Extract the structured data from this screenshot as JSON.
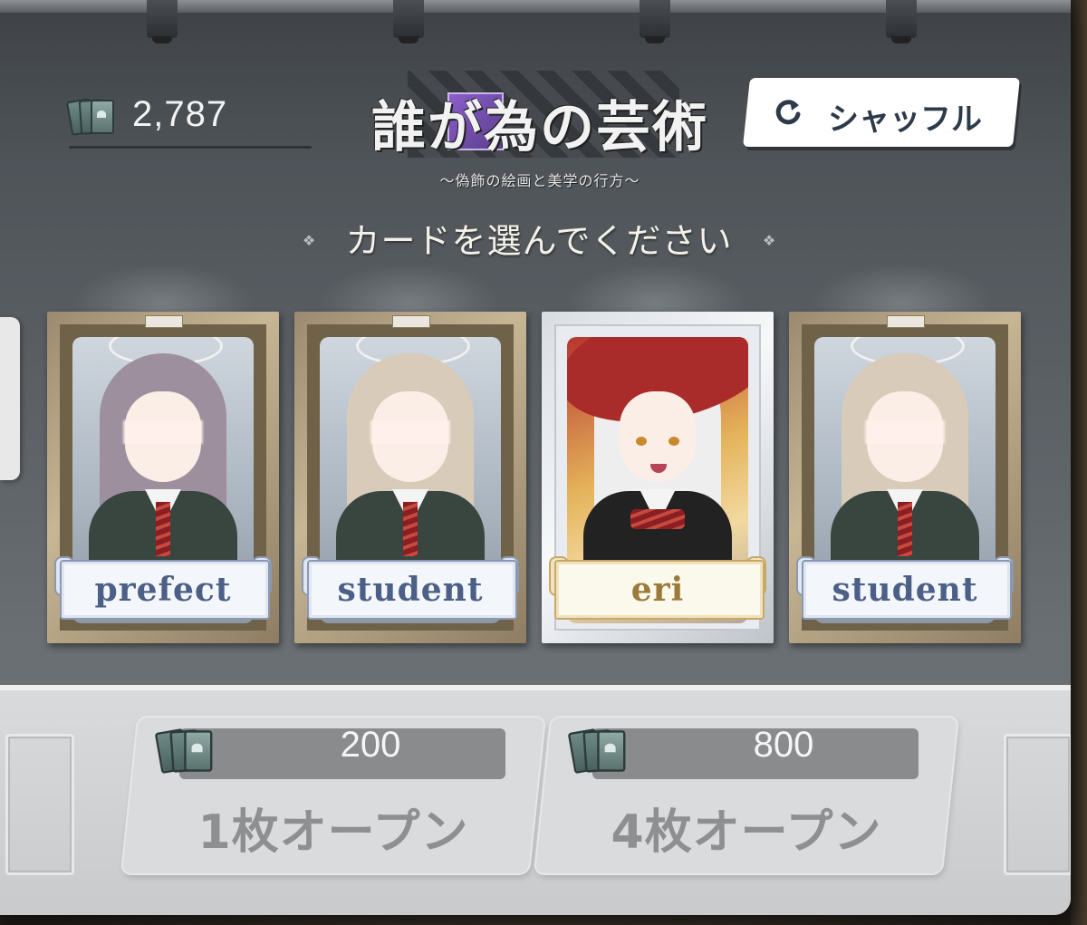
{
  "currency": {
    "value": "2,787",
    "icon": "card-stack-icon"
  },
  "title": {
    "main": "誰が為の芸術",
    "subtitle": "〜偽飾の絵画と美学の行方〜"
  },
  "shuffle": {
    "label": "シャッフル",
    "icon": "rotate-arrow-icon"
  },
  "prompt": "カードを選んでください",
  "cards": [
    {
      "label": "prefect",
      "variant": "prefect"
    },
    {
      "label": "student",
      "variant": "student"
    },
    {
      "label": "eri",
      "variant": "special"
    },
    {
      "label": "student",
      "variant": "student"
    }
  ],
  "open_buttons": [
    {
      "cost": "200",
      "label": "1枚オープン"
    },
    {
      "cost": "800",
      "label": "4枚オープン"
    }
  ],
  "colors": {
    "panel": "#4f5459",
    "accent_text": "#f4f1e8",
    "banner_text": "#4c5f86",
    "special_banner_text": "#9a7b3a",
    "button_disabled_text": "#8e8f91"
  }
}
